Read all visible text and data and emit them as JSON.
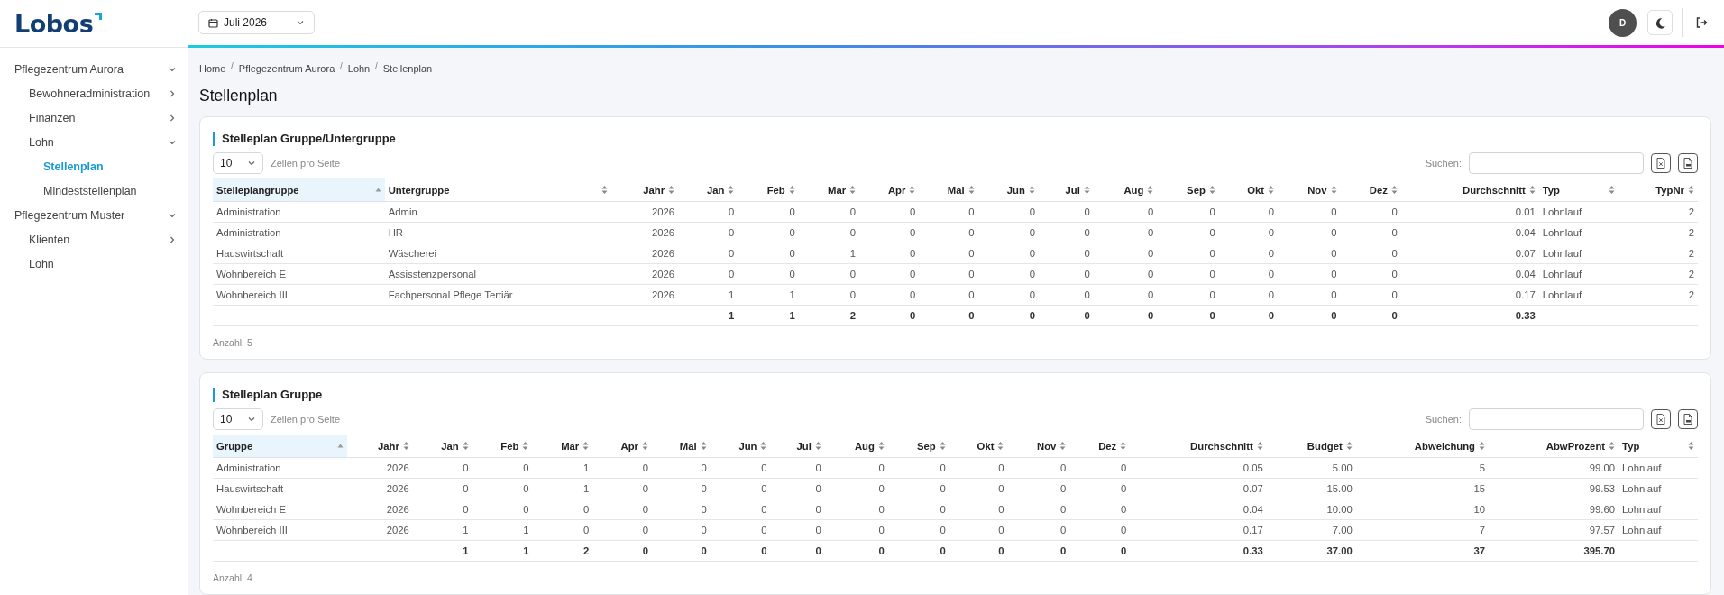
{
  "header": {
    "logo": "Lobos",
    "month_picker": {
      "value": "Juli 2026"
    },
    "avatar": "D"
  },
  "sidebar": {
    "items": [
      {
        "label": "Pflegezentrum Aurora",
        "expanded": true,
        "selected": false,
        "children": [
          {
            "label": "Bewohneradministration",
            "expanded": false,
            "selected": false
          },
          {
            "label": "Finanzen",
            "expanded": false,
            "selected": false
          },
          {
            "label": "Lohn",
            "expanded": true,
            "selected": false,
            "children": [
              {
                "label": "Stellenplan",
                "selected": true
              },
              {
                "label": "Mindeststellenplan",
                "selected": false
              }
            ]
          }
        ]
      },
      {
        "label": "Pflegezentrum Muster",
        "expanded": true,
        "selected": false,
        "children": [
          {
            "label": "Klienten",
            "expanded": false,
            "selected": false
          },
          {
            "label": "Lohn",
            "selected": false
          }
        ]
      }
    ]
  },
  "breadcrumb": {
    "separator": "/",
    "items": [
      "Home",
      "Pflegezentrum Aurora",
      "Lohn",
      "Stellenplan"
    ]
  },
  "page_title": "Stellenplan",
  "sections": [
    {
      "title": "Stelleplan Gruppe/Untergruppe",
      "page_size": "10",
      "page_size_label": "Zellen pro Seite",
      "search_label": "Suchen:",
      "exports": [
        {
          "kind": "excel"
        },
        {
          "kind": "pdf"
        }
      ],
      "columns": [
        {
          "label": "Stelleplangruppe",
          "kind": "text",
          "sorted": true,
          "summed": false
        },
        {
          "label": "Untergruppe",
          "kind": "text",
          "sorted": false,
          "summed": false
        },
        {
          "label": "Jahr",
          "kind": "number",
          "sorted": false,
          "summed": false
        },
        {
          "label": "Jan",
          "kind": "number",
          "sorted": false,
          "summed": true
        },
        {
          "label": "Feb",
          "kind": "number",
          "sorted": false,
          "summed": true
        },
        {
          "label": "Mar",
          "kind": "number",
          "sorted": false,
          "summed": true
        },
        {
          "label": "Apr",
          "kind": "number",
          "sorted": false,
          "summed": true
        },
        {
          "label": "Mai",
          "kind": "number",
          "sorted": false,
          "summed": true
        },
        {
          "label": "Jun",
          "kind": "number",
          "sorted": false,
          "summed": true
        },
        {
          "label": "Jul",
          "kind": "number",
          "sorted": false,
          "summed": true
        },
        {
          "label": "Aug",
          "kind": "number",
          "sorted": false,
          "summed": true
        },
        {
          "label": "Sep",
          "kind": "number",
          "sorted": false,
          "summed": true
        },
        {
          "label": "Okt",
          "kind": "number",
          "sorted": false,
          "summed": true
        },
        {
          "label": "Nov",
          "kind": "number",
          "sorted": false,
          "summed": true
        },
        {
          "label": "Dez",
          "kind": "number",
          "sorted": false,
          "summed": true
        },
        {
          "label": "Durchschnitt",
          "kind": "number",
          "sorted": false,
          "summed": true
        },
        {
          "label": "Typ",
          "kind": "text",
          "sorted": false,
          "summed": false
        },
        {
          "label": "TypNr",
          "kind": "number",
          "sorted": false,
          "summed": false
        }
      ],
      "rows": [
        [
          "Administration",
          "Admin",
          "2026",
          "0",
          "0",
          "0",
          "0",
          "0",
          "0",
          "0",
          "0",
          "0",
          "0",
          "0",
          "0",
          "0.01",
          "Lohnlauf",
          "2"
        ],
        [
          "Administration",
          "HR",
          "2026",
          "0",
          "0",
          "0",
          "0",
          "0",
          "0",
          "0",
          "0",
          "0",
          "0",
          "0",
          "0",
          "0.04",
          "Lohnlauf",
          "2"
        ],
        [
          "Hauswirtschaft",
          "Wäscherei",
          "2026",
          "0",
          "0",
          "1",
          "0",
          "0",
          "0",
          "0",
          "0",
          "0",
          "0",
          "0",
          "0",
          "0.07",
          "Lohnlauf",
          "2"
        ],
        [
          "Wohnbereich E",
          "Assisstenzpersonal",
          "2026",
          "0",
          "0",
          "0",
          "0",
          "0",
          "0",
          "0",
          "0",
          "0",
          "0",
          "0",
          "0",
          "0.04",
          "Lohnlauf",
          "2"
        ],
        [
          "Wohnbereich III",
          "Fachpersonal Pflege Tertiär",
          "2026",
          "1",
          "1",
          "0",
          "0",
          "0",
          "0",
          "0",
          "0",
          "0",
          "0",
          "0",
          "0",
          "0.17",
          "Lohnlauf",
          "2"
        ]
      ],
      "totals": [
        "1",
        "1",
        "2",
        "0",
        "0",
        "0",
        "0",
        "0",
        "0",
        "0",
        "0",
        "0",
        "0.33"
      ],
      "count": "Anzahl: 5"
    },
    {
      "title": "Stelleplan Gruppe",
      "page_size": "10",
      "page_size_label": "Zellen pro Seite",
      "search_label": "Suchen:",
      "exports": [
        {
          "kind": "excel"
        },
        {
          "kind": "pdf"
        }
      ],
      "columns": [
        {
          "label": "Gruppe",
          "kind": "text",
          "sorted": true,
          "summed": false
        },
        {
          "label": "Jahr",
          "kind": "number",
          "sorted": false,
          "summed": false
        },
        {
          "label": "Jan",
          "kind": "number",
          "sorted": false,
          "summed": true
        },
        {
          "label": "Feb",
          "kind": "number",
          "sorted": false,
          "summed": true
        },
        {
          "label": "Mar",
          "kind": "number",
          "sorted": false,
          "summed": true
        },
        {
          "label": "Apr",
          "kind": "number",
          "sorted": false,
          "summed": true
        },
        {
          "label": "Mai",
          "kind": "number",
          "sorted": false,
          "summed": true
        },
        {
          "label": "Jun",
          "kind": "number",
          "sorted": false,
          "summed": true
        },
        {
          "label": "Jul",
          "kind": "number",
          "sorted": false,
          "summed": true
        },
        {
          "label": "Aug",
          "kind": "number",
          "sorted": false,
          "summed": true
        },
        {
          "label": "Sep",
          "kind": "number",
          "sorted": false,
          "summed": true
        },
        {
          "label": "Okt",
          "kind": "number",
          "sorted": false,
          "summed": true
        },
        {
          "label": "Nov",
          "kind": "number",
          "sorted": false,
          "summed": true
        },
        {
          "label": "Dez",
          "kind": "number",
          "sorted": false,
          "summed": true
        },
        {
          "label": "Durchschnitt",
          "kind": "number",
          "sorted": false,
          "summed": true
        },
        {
          "label": "Budget",
          "kind": "number",
          "sorted": false,
          "summed": true
        },
        {
          "label": "Abweichung",
          "kind": "number",
          "sorted": false,
          "summed": true
        },
        {
          "label": "AbwProzent",
          "kind": "number",
          "sorted": false,
          "summed": true
        },
        {
          "label": "Typ",
          "kind": "text",
          "sorted": false,
          "summed": false
        }
      ],
      "rows": [
        [
          "Administration",
          "2026",
          "0",
          "0",
          "1",
          "0",
          "0",
          "0",
          "0",
          "0",
          "0",
          "0",
          "0",
          "0",
          "0.05",
          "5.00",
          "5",
          "99.00",
          "Lohnlauf"
        ],
        [
          "Hauswirtschaft",
          "2026",
          "0",
          "0",
          "1",
          "0",
          "0",
          "0",
          "0",
          "0",
          "0",
          "0",
          "0",
          "0",
          "0.07",
          "15.00",
          "15",
          "99.53",
          "Lohnlauf"
        ],
        [
          "Wohnbereich E",
          "2026",
          "0",
          "0",
          "0",
          "0",
          "0",
          "0",
          "0",
          "0",
          "0",
          "0",
          "0",
          "0",
          "0.04",
          "10.00",
          "10",
          "99.60",
          "Lohnlauf"
        ],
        [
          "Wohnbereich III",
          "2026",
          "1",
          "1",
          "0",
          "0",
          "0",
          "0",
          "0",
          "0",
          "0",
          "0",
          "0",
          "0",
          "0.17",
          "7.00",
          "7",
          "97.57",
          "Lohnlauf"
        ]
      ],
      "totals": [
        "1",
        "1",
        "2",
        "0",
        "0",
        "0",
        "0",
        "0",
        "0",
        "0",
        "0",
        "0",
        "0.33",
        "37.00",
        "37",
        "395.70"
      ],
      "count": "Anzahl: 4"
    }
  ]
}
